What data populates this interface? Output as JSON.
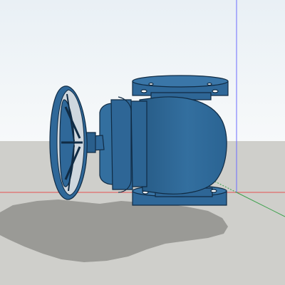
{
  "viewport": {
    "sky_top_color": "#e9f0f5",
    "sky_bottom_color": "#f7f9fa",
    "ground_color": "#cfcfcb",
    "model_color": "#2f6899",
    "edge_color": "#102b44",
    "shadow_color": "#9a9a96"
  },
  "axes": {
    "x_axis_color": "#e55050",
    "y_axis_color": "#3aa04a",
    "z_axis_color": "#6b6bff"
  }
}
